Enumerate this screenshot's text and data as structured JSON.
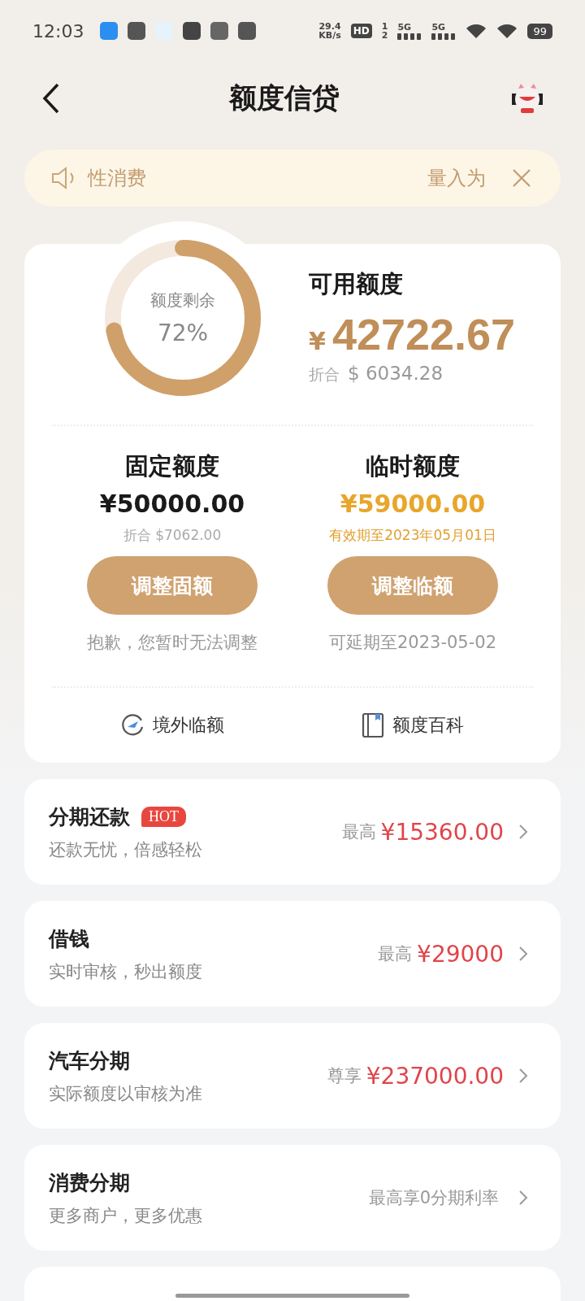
{
  "status_bar": {
    "time": "12:03",
    "speed": "29.4",
    "speed_unit": "KB/s",
    "hd": "HD",
    "sim_1": "1",
    "sim_2": "2",
    "networks": [
      "5G",
      "5G"
    ],
    "battery": "99"
  },
  "header": {
    "title": "额度信贷"
  },
  "notice": {
    "texts": [
      "性消费",
      "量入为"
    ]
  },
  "credit": {
    "ring_label": "额度剩余",
    "ring_value": "72%",
    "level": 0.72,
    "available_label": "可用额度",
    "currency": "¥",
    "available_amount": "42722.67",
    "converted_label": "折合",
    "converted_amount": "$ 6034.28"
  },
  "limits": [
    {
      "title": "固定额度",
      "amount": "¥50000.00",
      "highlight": false,
      "note": "折合 $7062.00",
      "button": "调整固额",
      "hint": "抱歉，您暂时无法调整"
    },
    {
      "title": "临时额度",
      "amount": "¥59000.00",
      "highlight": true,
      "note": "有效期至2023年05月01日",
      "button": "调整临额",
      "hint": "可延期至2023-05-02"
    }
  ],
  "links": [
    {
      "kind": "overseas",
      "label": "境外临额"
    },
    {
      "kind": "guide",
      "label": "额度百科"
    }
  ],
  "products": [
    {
      "title": "分期还款",
      "badge": "HOT",
      "subtitle": "还款无忧，倍感轻松",
      "prefix": "最高",
      "amount": "¥15360.00"
    },
    {
      "title": "借钱",
      "subtitle": "实时审核，秒出额度",
      "prefix": "最高",
      "amount": "¥29000"
    },
    {
      "title": "汽车分期",
      "subtitle": "实际额度以审核为准",
      "prefix": "尊享",
      "amount": "¥237000.00"
    },
    {
      "title": "消费分期",
      "subtitle": "更多商户，更多优惠",
      "prefix": "最高享0分期利率"
    }
  ]
}
